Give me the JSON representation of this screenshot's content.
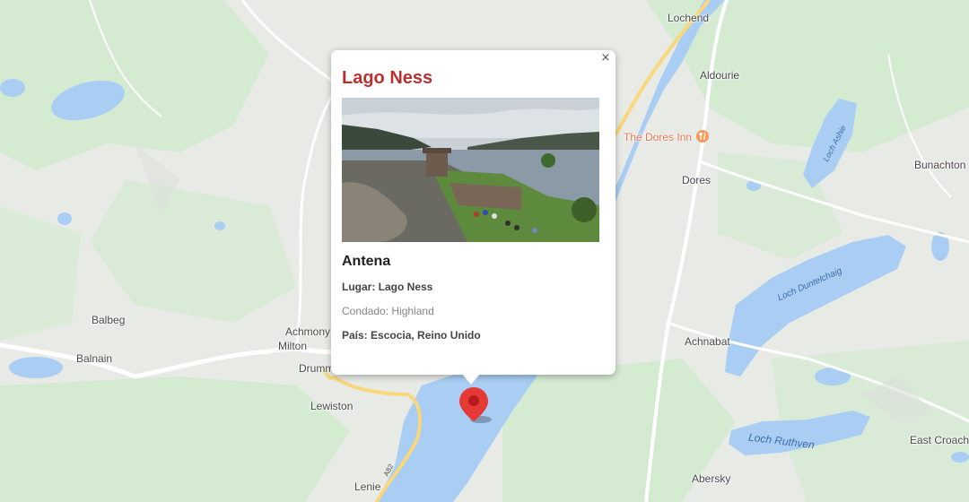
{
  "map": {
    "places": {
      "lochend": "Lochend",
      "aldourie": "Aldourie",
      "dores_inn": "The Dores Inn",
      "dores": "Dores",
      "bunachton": "Bunachton",
      "achnabat": "Achnabat",
      "balbeg": "Balbeg",
      "balnain": "Balnain",
      "achmony": "Achmony",
      "milton": "Milton",
      "drumm": "Drumm",
      "lewiston": "Lewiston",
      "lenie": "Lenie",
      "abersky": "Abersky",
      "east_croach": "East Croach"
    },
    "water": {
      "loch_ashie": "Loch Ashie",
      "loch_duntelchaig": "Loch Duntelchaig",
      "loch_ruthven": "Loch Ruthven"
    },
    "roads": {
      "a82": "A82"
    },
    "colors": {
      "water": "#a9cdf3",
      "land": "#e8eae6",
      "green": "#d4ebd2",
      "road": "#ffffff",
      "major_road": "#f9d77a",
      "pin": "#e53935"
    }
  },
  "popup": {
    "title": "Lago Ness",
    "subtitle": "Antena",
    "close_symbol": "×",
    "photo_icon": "castle-photo",
    "lugar": "Lugar: Lago Ness",
    "condado": "Condado: Highland",
    "pais": "País: Escocia, Reino Unido"
  }
}
